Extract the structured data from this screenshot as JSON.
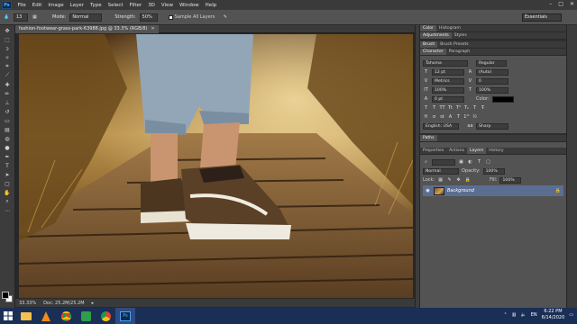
{
  "menubar": {
    "logo": "Ps",
    "items": [
      "File",
      "Edit",
      "Image",
      "Layer",
      "Type",
      "Select",
      "Filter",
      "3D",
      "View",
      "Window",
      "Help"
    ]
  },
  "optionsbar": {
    "brush_size": "13",
    "mode_label": "Mode:",
    "mode_value": "Normal",
    "strength_label": "Strength:",
    "strength_value": "50%",
    "sample_label": "Sample All Layers",
    "workspace": "Essentials"
  },
  "document": {
    "tab_title": "fashion-footwear-grass-park-63988.jpg @ 33.3% (RGB/8)",
    "zoom": "33.33%",
    "doc_size": "Doc: 25.2M/25.2M"
  },
  "panels": {
    "top_tabs": [
      "Color",
      "Histogram"
    ],
    "adj_tabs": [
      "Adjustments",
      "Styles"
    ],
    "brush_tabs": [
      "Brush",
      "Brush Presets"
    ],
    "char_tabs": [
      "Character",
      "Paragraph"
    ],
    "font_family": "Tahoma",
    "font_style": "Regular",
    "font_size": "12 pt",
    "leading": "(Auto)",
    "kerning": "Metrics",
    "tracking": "0",
    "vscale": "100%",
    "hscale": "100%",
    "baseline": "0 pt",
    "color_label": "Color:",
    "language": "English: USA",
    "aa": "Sharp",
    "paths_tab": "Paths",
    "layer_tabs": [
      "Properties",
      "Actions",
      "Layers",
      "History"
    ],
    "blend_mode": "Normal",
    "opacity_label": "Opacity:",
    "opacity": "100%",
    "lock_label": "Lock:",
    "fill_label": "Fill:",
    "fill": "100%",
    "layer_name": "Background"
  },
  "taskbar": {
    "lang": "EN",
    "time": "6:22 PM",
    "date": "6/14/2020"
  }
}
